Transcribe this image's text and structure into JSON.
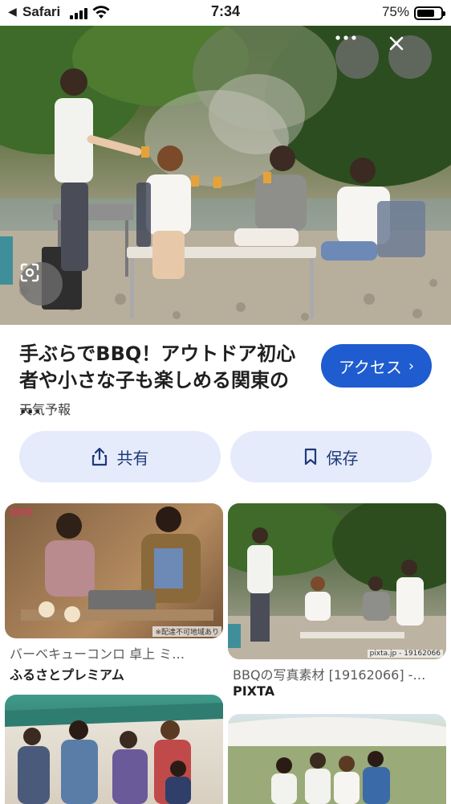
{
  "status_bar": {
    "back_arrow": "◀",
    "carrier": "Safari",
    "time": "7:34",
    "battery_percent": "75%",
    "battery_level": 0.75
  },
  "hero": {
    "more_icon": "more-horizontal-icon",
    "close_icon": "close-icon",
    "lens_icon": "lens-search-icon"
  },
  "result": {
    "title": "手ぶらでBBQ！アウトドア初心者や小さな子も楽しめる関東の ...",
    "source": "天気予報",
    "access_label": "アクセス",
    "share_label": "共有",
    "save_label": "保存"
  },
  "related": [
    {
      "caption": "バーベキューコンロ 卓上 ミ…",
      "source": "ふるさとプレミアム",
      "overlay_text": "※配達不可地域あり",
      "logo_text": "IRIS"
    },
    {
      "caption": "BBQの写真素材 [19162066] -…",
      "source": "PIXTA",
      "overlay_text": "pixta.jp - 19162066"
    },
    {
      "caption": "",
      "source": ""
    },
    {
      "caption": "",
      "source": ""
    }
  ],
  "colors": {
    "access_button": "#1f5cd0",
    "action_button_bg": "#e5ebfb",
    "action_button_text": "#1f3a7a"
  }
}
